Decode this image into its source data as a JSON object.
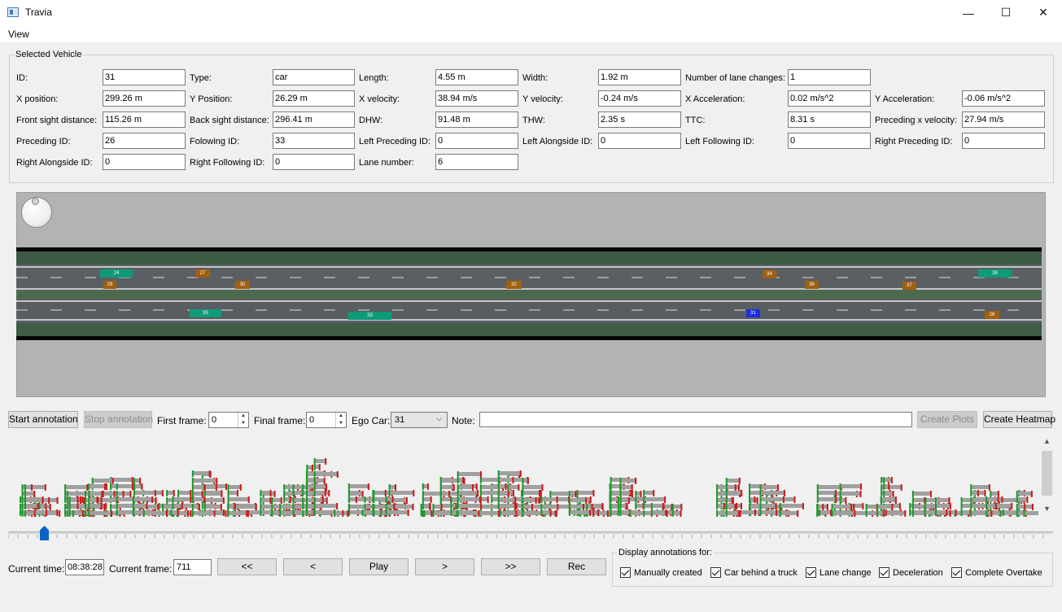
{
  "window": {
    "title": "Travia",
    "minimize_glyph": "—",
    "maximize_glyph": "☐",
    "close_glyph": "✕"
  },
  "menu": {
    "view": "View"
  },
  "selected_vehicle": {
    "group_title": "Selected Vehicle",
    "fields": [
      {
        "label": "ID:",
        "value": "31"
      },
      {
        "label": "Type:",
        "value": "car"
      },
      {
        "label": "Length:",
        "value": "4.55 m"
      },
      {
        "label": "Width:",
        "value": "1.92 m"
      },
      {
        "label": "Number of lane changes:",
        "value": "1"
      },
      {
        "label": "X position:",
        "value": "299.26 m"
      },
      {
        "label": "Y Position:",
        "value": "26.29 m"
      },
      {
        "label": "X velocity:",
        "value": "38.94 m/s"
      },
      {
        "label": "Y velocity:",
        "value": "-0.24 m/s"
      },
      {
        "label": "X Acceleration:",
        "value": "0.02 m/s^2"
      },
      {
        "label": "Y Acceleration:",
        "value": "-0.06 m/s^2"
      },
      {
        "label": "Front sight distance:",
        "value": "115.26 m"
      },
      {
        "label": "Back sight distance:",
        "value": "296.41 m"
      },
      {
        "label": "DHW:",
        "value": "91.48 m"
      },
      {
        "label": "THW:",
        "value": "2.35 s"
      },
      {
        "label": "TTC:",
        "value": "8.31 s"
      },
      {
        "label": "Preceding x velocity:",
        "value": "27.94 m/s"
      },
      {
        "label": "Preceding ID:",
        "value": "26"
      },
      {
        "label": "Folowing ID:",
        "value": "33"
      },
      {
        "label": "Left Preceding ID:",
        "value": "0"
      },
      {
        "label": "Left Alongside ID:",
        "value": "0"
      },
      {
        "label": "Left Following ID:",
        "value": "0"
      },
      {
        "label": "Right Preceding ID:",
        "value": "0"
      },
      {
        "label": "Right Alongside ID:",
        "value": "0"
      },
      {
        "label": "Right Following ID:",
        "value": "0"
      },
      {
        "label": "Lane number:",
        "value": "6"
      }
    ]
  },
  "road_view": {
    "vehicles": [
      {
        "id": "24",
        "color": "#0f9a78"
      },
      {
        "id": "27",
        "color": "#a0600e"
      },
      {
        "id": "29",
        "color": "#a0600e"
      },
      {
        "id": "30",
        "color": "#a0600e"
      },
      {
        "id": "32",
        "color": "#a0600e"
      },
      {
        "id": "34",
        "color": "#a0600e"
      },
      {
        "id": "36",
        "color": "#a0600e"
      },
      {
        "id": "37",
        "color": "#a0600e"
      },
      {
        "id": "38",
        "color": "#0f9a78"
      },
      {
        "id": "35",
        "color": "#0f9a78"
      },
      {
        "id": "33",
        "color": "#0f9a78"
      },
      {
        "id": "31",
        "color": "#1a2fe0"
      },
      {
        "id": "26",
        "color": "#a0600e"
      }
    ]
  },
  "controls": {
    "start_annotation": "Start annotation",
    "stop_annotation": "Stop annotation",
    "first_frame_label": "First frame:",
    "first_frame_value": "0",
    "final_frame_label": "Final frame:",
    "final_frame_value": "0",
    "ego_car_label": "Ego Car:",
    "ego_car_value": "31",
    "note_label": "Note:",
    "note_value": "",
    "create_plots": "Create Plots",
    "create_heatmap": "Create Heatmap"
  },
  "playback": {
    "current_time_label": "Current time:",
    "current_time_value": "08:38:28",
    "current_frame_label": "Current frame:",
    "current_frame_value": "711",
    "btn_first": "<<",
    "btn_prev": "<",
    "btn_play": "Play",
    "btn_next": ">",
    "btn_last": ">>",
    "btn_rec": "Rec"
  },
  "display_annotations": {
    "title": "Display annotations for:",
    "options": [
      {
        "label": "Manually created",
        "checked": true
      },
      {
        "label": "Car behind a truck",
        "checked": true
      },
      {
        "label": "Lane change",
        "checked": true
      },
      {
        "label": "Deceleration",
        "checked": true
      },
      {
        "label": "Complete Overtake",
        "checked": true
      }
    ]
  },
  "colors": {
    "accent": "#0a64c8",
    "timeline_bar": "#a0a0a0",
    "timeline_start": "#1a9a2a",
    "timeline_end": "#d01818",
    "lane_green": "#0f9a78",
    "lane_brown": "#a0600e",
    "ego_blue": "#1a2fe0"
  }
}
